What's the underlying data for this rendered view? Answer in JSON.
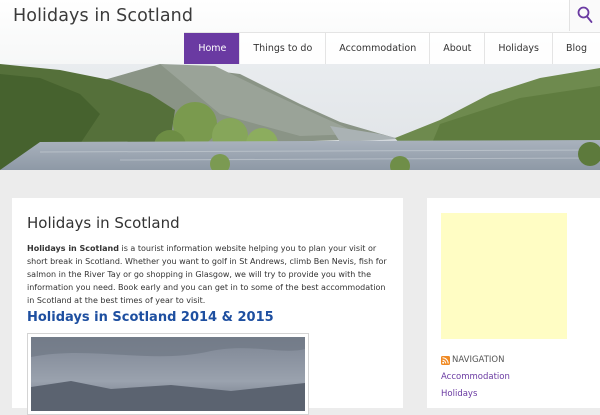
{
  "header": {
    "site_title": "Holidays in Scotland",
    "nav": [
      {
        "label": "Home",
        "active": true
      },
      {
        "label": "Things to do",
        "active": false
      },
      {
        "label": "Accommodation",
        "active": false
      },
      {
        "label": "About",
        "active": false
      },
      {
        "label": "Holidays",
        "active": false
      },
      {
        "label": "Blog",
        "active": false
      }
    ],
    "search_icon": "search-icon"
  },
  "main": {
    "page_title": "Holidays in Scotland",
    "intro_bold": "Holidays in Scotland",
    "intro_rest": " is a tourist information website helping you to plan your visit or short break in Scotland. Whether you want to golf in St Andrews, climb Ben Nevis, fish for salmon in the River Tay or go shopping in Glasgow, we will try to provide you with the information you need. Book early and you can get in to some of the best accommodation in Scotland at the best times of year to visit.",
    "sub_heading": "Holidays in Scotland 2014 & 2015"
  },
  "sidebar": {
    "widget_title": "NAVIGATION",
    "links": [
      "Accommodation",
      "Holidays"
    ]
  },
  "colors": {
    "accent": "#6a3aa2",
    "heading_blue": "#1e4fa0",
    "ad_background": "#fffdc4",
    "page_background": "#ececec"
  }
}
